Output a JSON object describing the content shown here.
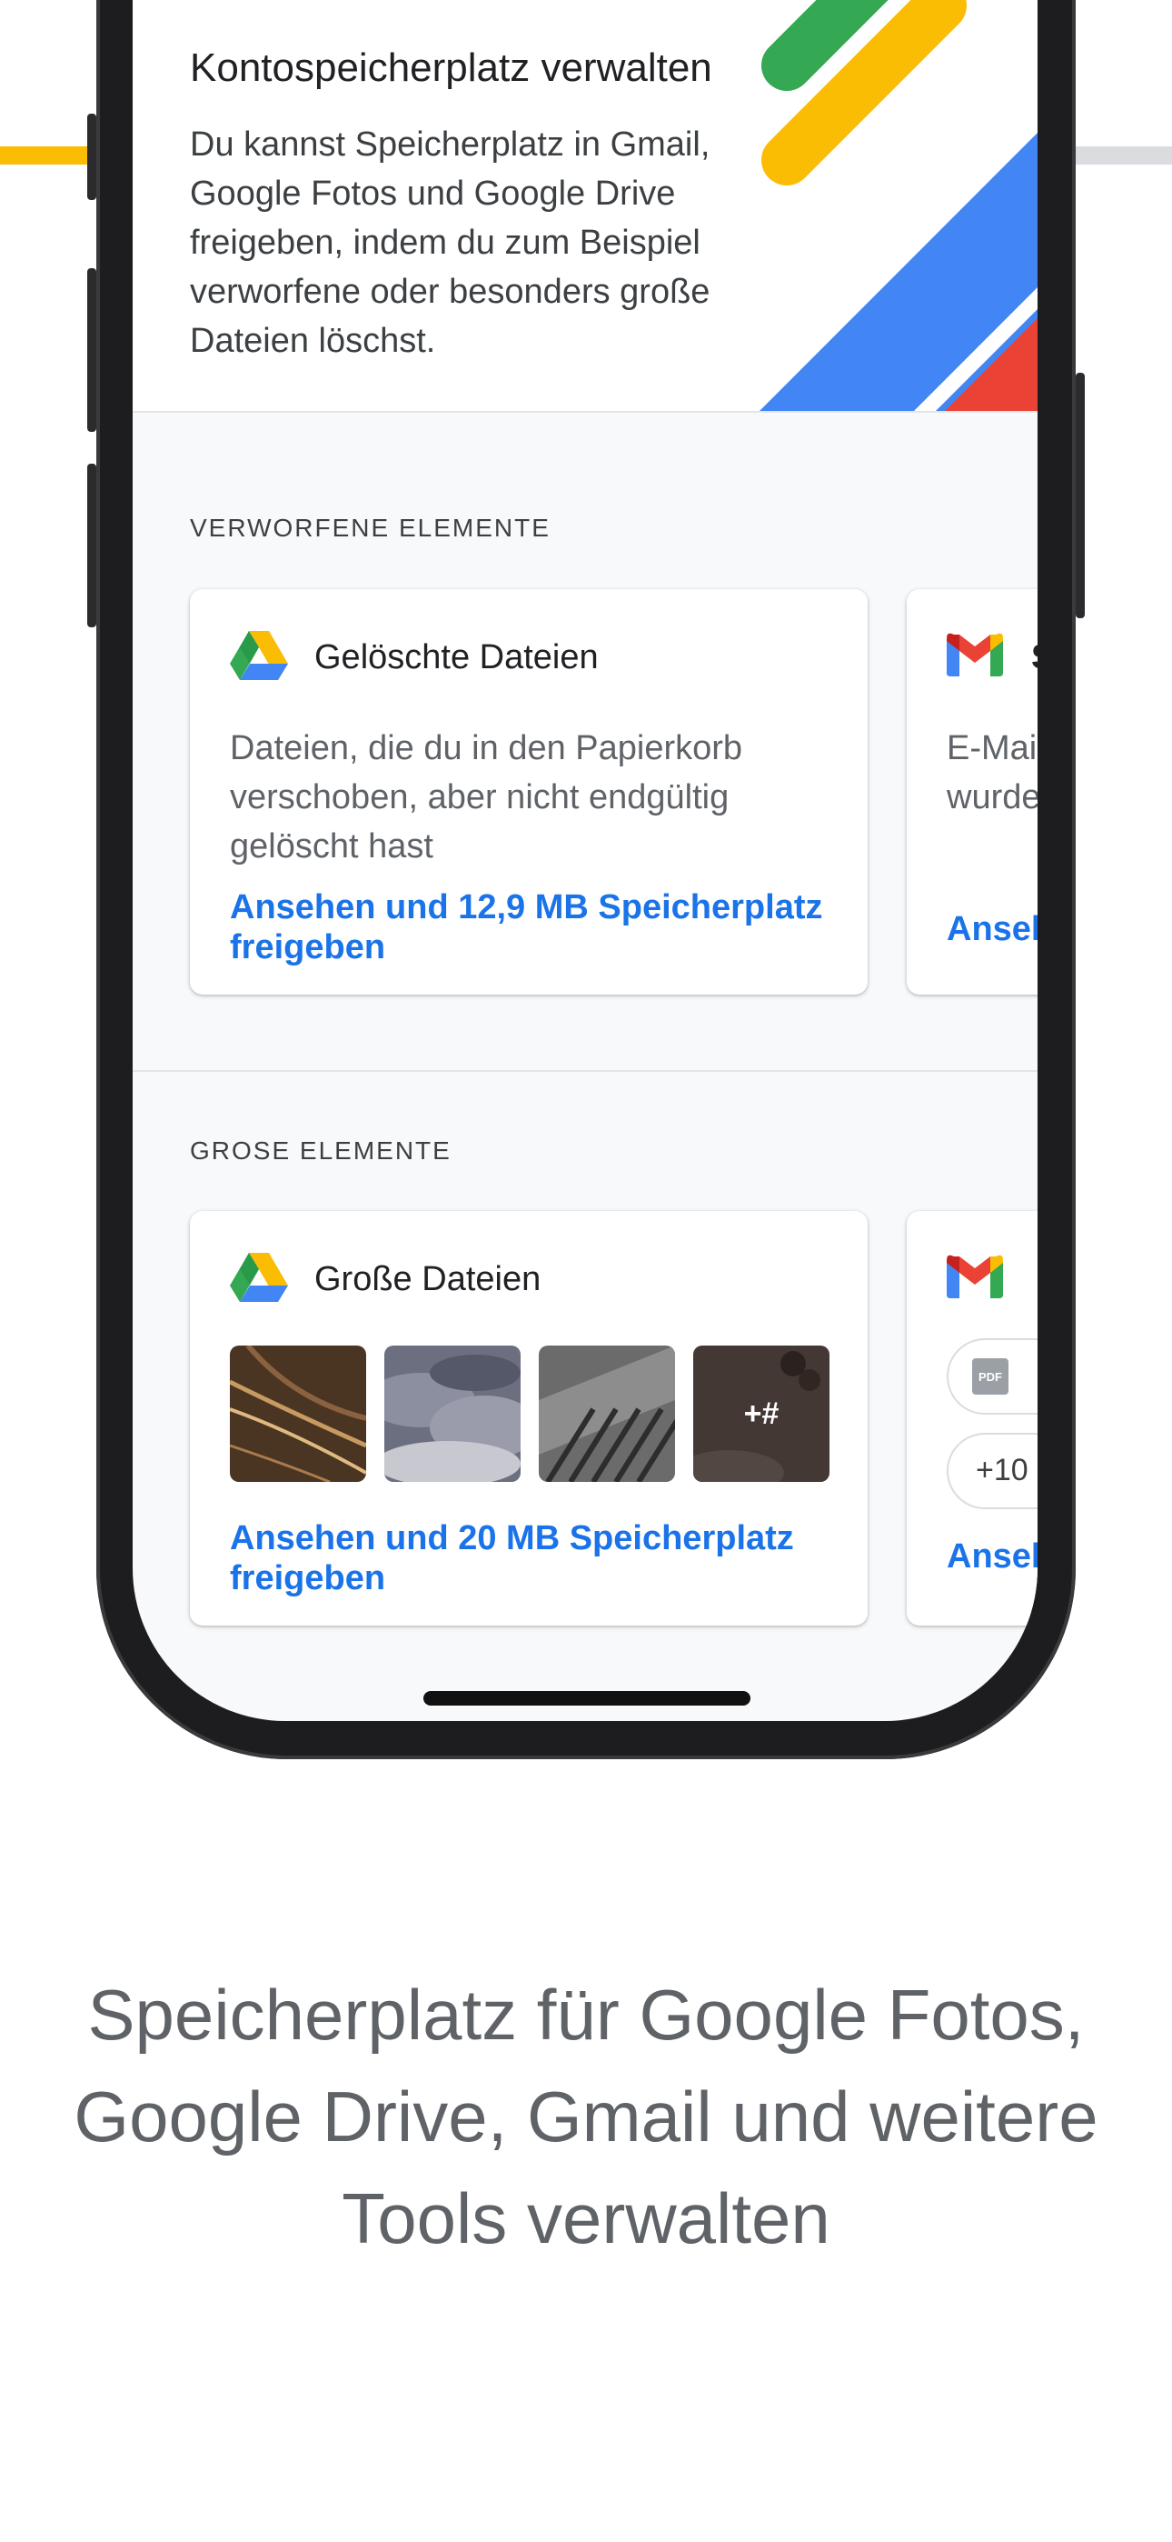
{
  "header": {
    "title": "Kontospeicherplatz verwalten",
    "description": "Du kannst Speicherplatz in Gmail, Google Fotos und Google Drive freigeben, indem du zum Beispiel verworfene oder besonders große Dateien löschst."
  },
  "sections": {
    "discarded": {
      "label": "VERWORFENE ELEMENTE",
      "drive_card": {
        "title": "Gelöschte Dateien",
        "body": "Dateien, die du in den Papierkorb verschoben, aber nicht endgültig gelöscht hast",
        "link": "Ansehen und 12,9 MB Speicherplatz freigeben"
      },
      "gmail_card": {
        "title_partial": "S",
        "body_partial": "E-Mai\nwurde",
        "link_partial": "Anseh"
      }
    },
    "large": {
      "label": "GROSE ELEMENTE",
      "drive_card": {
        "title": "Große Dateien",
        "more_badge": "+#",
        "link": "Ansehen und 20 MB Speicherplatz freigeben"
      },
      "gmail_card": {
        "pdf_label": "PDF",
        "chip_count": "+10",
        "link_partial": "Anseh"
      }
    }
  },
  "caption": "Speicherplatz für Google Fotos, Google Drive, Gmail und weitere Tools verwalten",
  "colors": {
    "google_blue": "#4285F4",
    "google_red": "#EA4335",
    "google_yellow": "#FBBC04",
    "google_green": "#34A853",
    "link_blue": "#1A73E8"
  }
}
